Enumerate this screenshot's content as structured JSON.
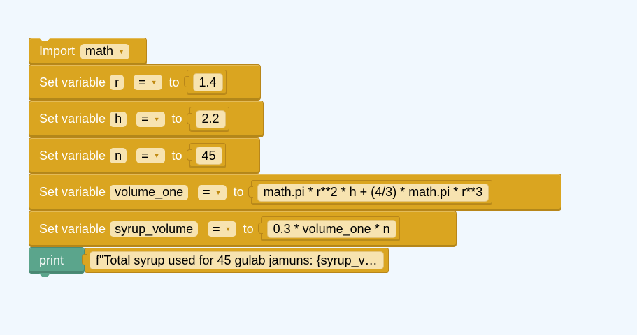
{
  "blocks": {
    "import": {
      "label": "Import",
      "module": "math"
    },
    "set_r": {
      "label": "Set variable",
      "var": "r",
      "op": "=",
      "to": "to",
      "value": "1.4"
    },
    "set_h": {
      "label": "Set variable",
      "var": "h",
      "op": "=",
      "to": "to",
      "value": "2.2"
    },
    "set_n": {
      "label": "Set variable",
      "var": "n",
      "op": "=",
      "to": "to",
      "value": "45"
    },
    "set_volume": {
      "label": "Set variable",
      "var": "volume_one",
      "op": "=",
      "to": "to",
      "value": "math.pi * r**2 * h + (4/3) * math.pi * r**3"
    },
    "set_syrup": {
      "label": "Set variable",
      "var": "syrup_volume",
      "op": "=",
      "to": "to",
      "value": "0.3 * volume_one * n"
    },
    "print": {
      "label": "print",
      "value": "f\"Total syrup used for 45 gulab jamuns: {syrup_v…"
    }
  },
  "colors": {
    "block_yellow": "#daa520",
    "block_green": "#5ba58c",
    "field_bg": "#f7e3b0",
    "workspace_bg": "#f1f8fe"
  }
}
